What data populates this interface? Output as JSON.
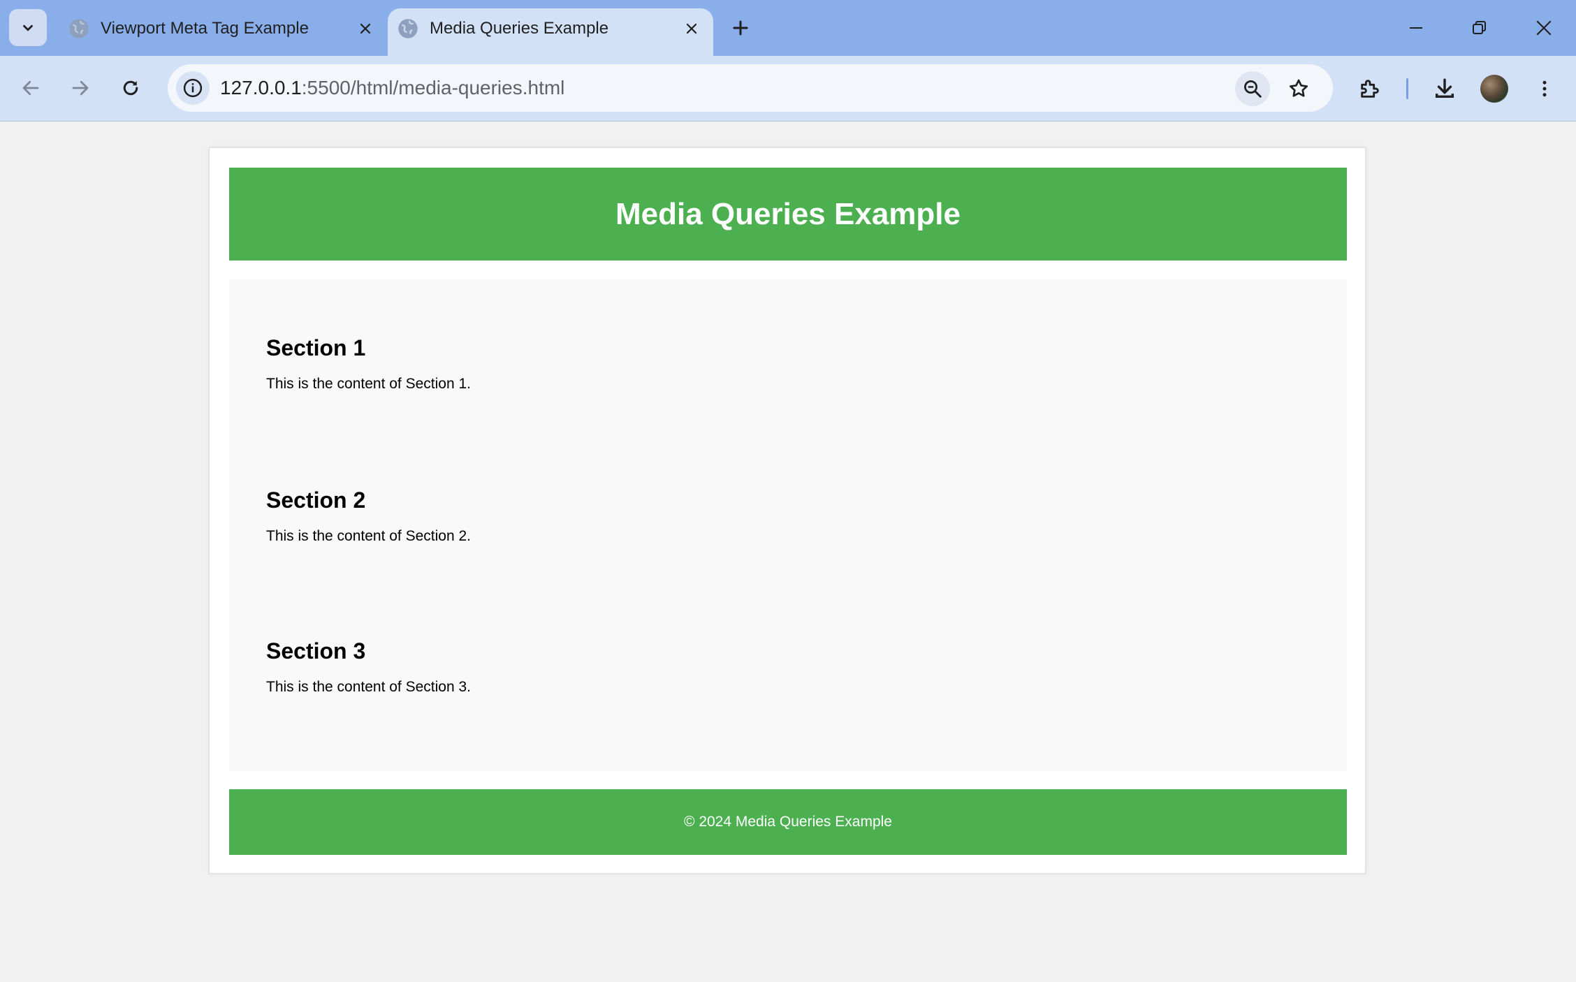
{
  "browser": {
    "tabs": [
      {
        "title": "Viewport Meta Tag Example",
        "active": false
      },
      {
        "title": "Media Queries Example",
        "active": true
      }
    ],
    "address": {
      "host": "127.0.0.1",
      "rest": ":5500/html/media-queries.html"
    }
  },
  "page": {
    "header_title": "Media Queries Example",
    "sections": [
      {
        "heading": "Section 1",
        "content": "This is the content of Section 1."
      },
      {
        "heading": "Section 2",
        "content": "This is the content of Section 2."
      },
      {
        "heading": "Section 3",
        "content": "This is the content of Section 3."
      }
    ],
    "footer_text": "© 2024 Media Queries Example"
  },
  "colors": {
    "accent_green": "#4caf50",
    "tabbar": "#8aaeea",
    "toolbar": "#d3e1f7"
  }
}
